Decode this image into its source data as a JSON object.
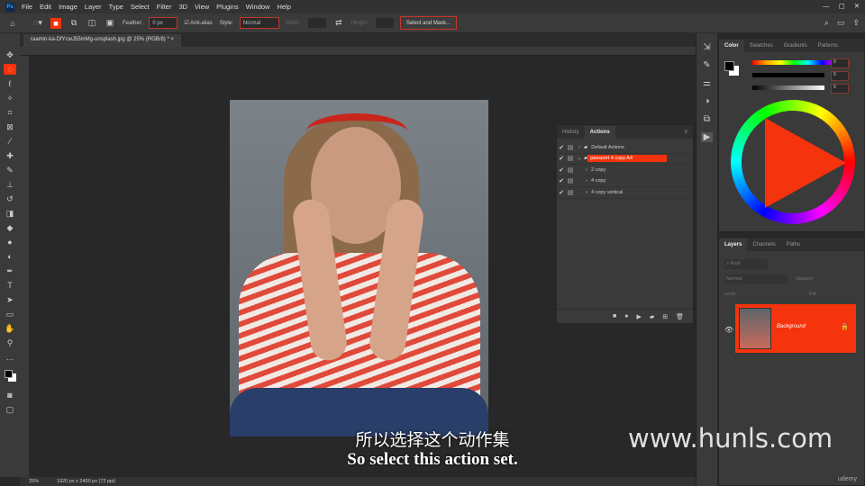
{
  "menu": [
    "File",
    "Edit",
    "Image",
    "Layer",
    "Type",
    "Select",
    "Filter",
    "3D",
    "View",
    "Plugins",
    "Window",
    "Help"
  ],
  "app_logo": "Ps",
  "options": {
    "feather_label": "Feather:",
    "feather_value": "0 px",
    "antialias_label": "Anti-alias",
    "style_label": "Style:",
    "style_value": "Normal",
    "width_label": "Width:",
    "height_label": "Height:",
    "select_mask": "Select and Mask..."
  },
  "document_tab": "raamin-ka-DfYcwJ55mMg-unsplash.jpg @ 25% (RGB/8) *",
  "status": {
    "zoom": "25%",
    "info": "1920 px x 2400 px (72 ppi)"
  },
  "color_panel": {
    "tabs": [
      "Color",
      "Swatches",
      "Gradients",
      "Patterns"
    ],
    "values": [
      "0",
      "0",
      "0"
    ],
    "accent": "#f5330c"
  },
  "actions_panel": {
    "tabs": [
      "History",
      "Actions"
    ],
    "rows": [
      {
        "label": "Default Actions",
        "type": "set",
        "selected": false
      },
      {
        "label": "passport 4 copy A4",
        "type": "set",
        "selected": true
      },
      {
        "label": "2 copy",
        "type": "action",
        "selected": false
      },
      {
        "label": "4 copy",
        "type": "action",
        "selected": false
      },
      {
        "label": "4 copy vertical",
        "type": "action",
        "selected": false
      }
    ]
  },
  "layers_panel": {
    "tabs": [
      "Layers",
      "Channels",
      "Paths"
    ],
    "search_placeholder": "Kind",
    "blend_mode": "Normal",
    "opacity_label": "Opacity:",
    "lock_label": "Lock:",
    "fill_label": "Fill:",
    "layer_name": "Background"
  },
  "subtitles": {
    "zh": "所以选择这个动作集",
    "en": "So select this action set."
  },
  "watermark": "www.hunls.com",
  "udemy": "udemy"
}
